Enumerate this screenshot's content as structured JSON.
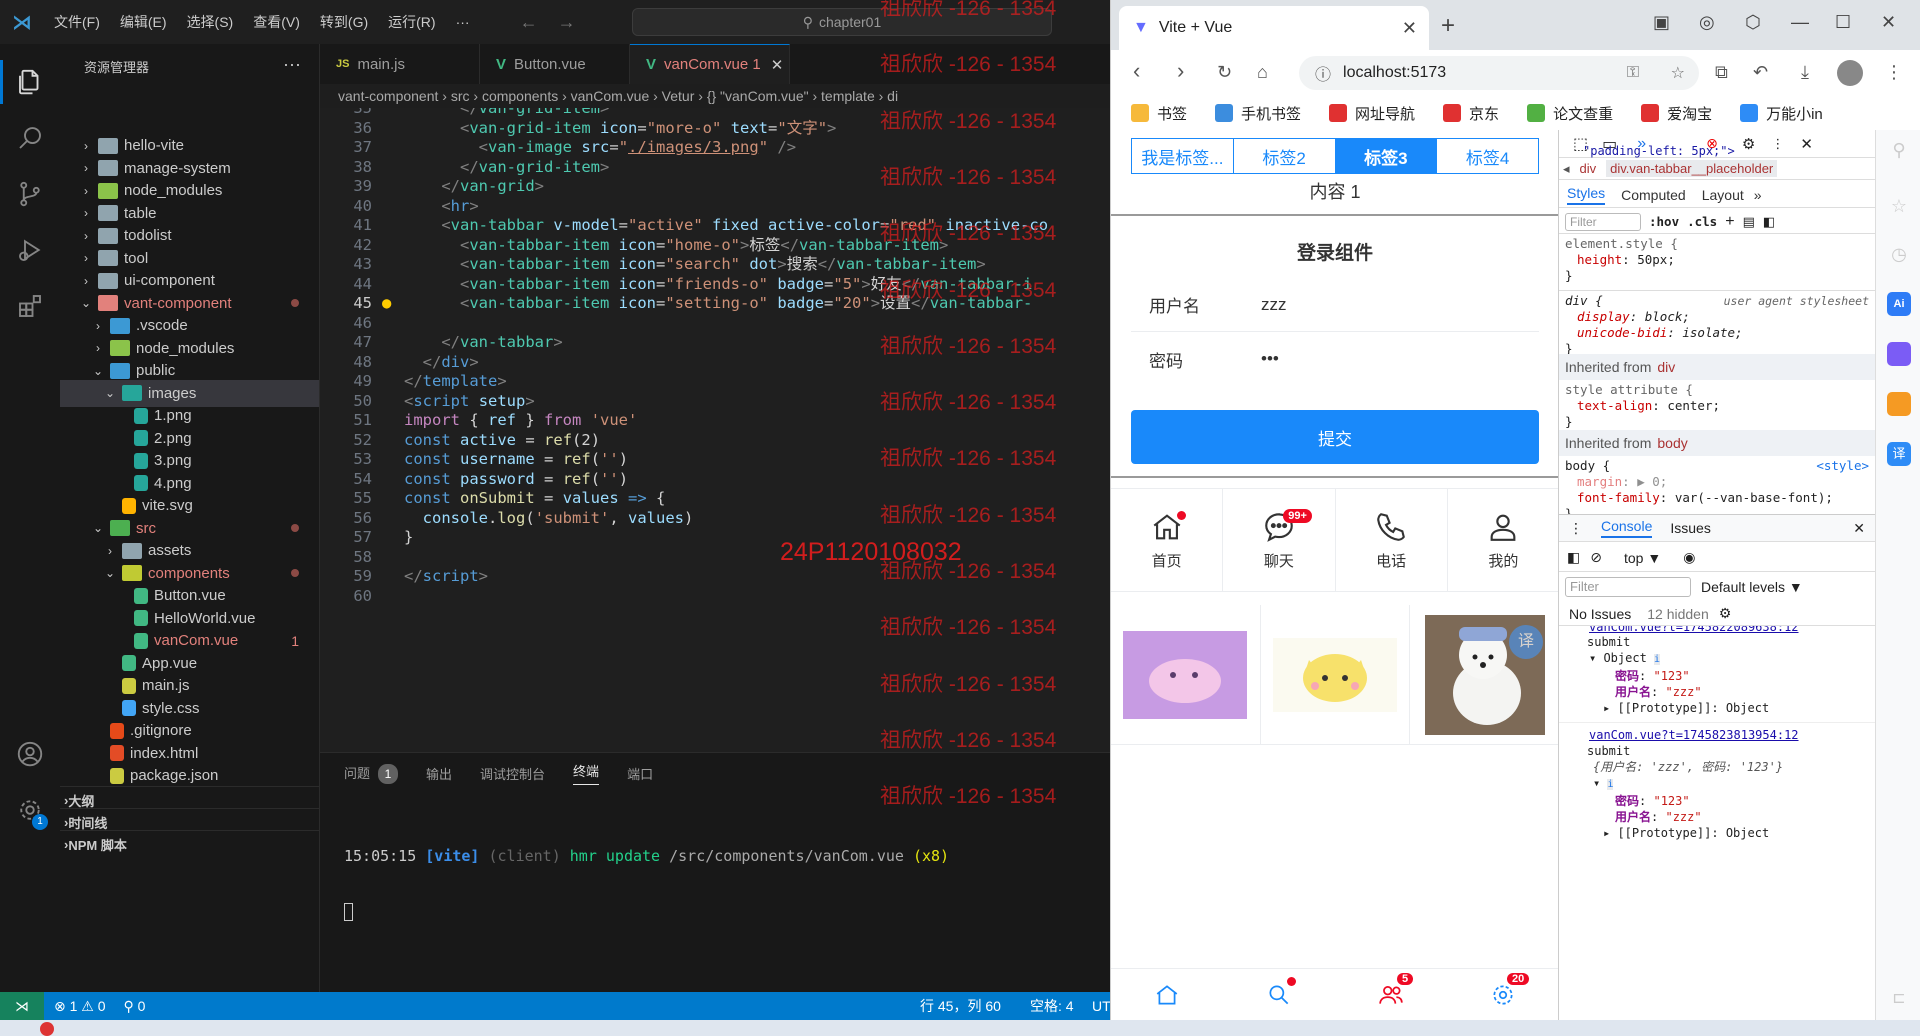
{
  "vscode": {
    "menu": [
      "文件(F)",
      "编辑(E)",
      "选择(S)",
      "查看(V)",
      "转到(G)",
      "运行(R)",
      "···"
    ],
    "command_center": "chapter01",
    "explorer_title": "资源管理器",
    "project": "CHAPTER01",
    "tree": [
      {
        "label": "hello-vite",
        "type": "folder"
      },
      {
        "label": "manage-system",
        "type": "folder"
      },
      {
        "label": "node_modules",
        "type": "folder-node"
      },
      {
        "label": "table",
        "type": "folder"
      },
      {
        "label": "todolist",
        "type": "folder"
      },
      {
        "label": "tool",
        "type": "folder"
      },
      {
        "label": "ui-component",
        "type": "folder"
      },
      {
        "label": "vant-component",
        "type": "folder-open-err"
      },
      {
        "label": ".vscode",
        "type": "folder-vscode"
      },
      {
        "label": "node_modules",
        "type": "folder-node"
      },
      {
        "label": "public",
        "type": "folder-public-open"
      },
      {
        "label": "images",
        "type": "folder-images-open"
      },
      {
        "label": "1.png",
        "type": "image"
      },
      {
        "label": "2.png",
        "type": "image"
      },
      {
        "label": "3.png",
        "type": "image"
      },
      {
        "label": "4.png",
        "type": "image"
      },
      {
        "label": "vite.svg",
        "type": "svg"
      },
      {
        "label": "src",
        "type": "folder-src-open-err"
      },
      {
        "label": "assets",
        "type": "folder"
      },
      {
        "label": "components",
        "type": "folder-comp-open-err"
      },
      {
        "label": "Button.vue",
        "type": "vue"
      },
      {
        "label": "HelloWorld.vue",
        "type": "vue"
      },
      {
        "label": "vanCom.vue",
        "type": "vue-err",
        "badge": "1"
      },
      {
        "label": "App.vue",
        "type": "vue"
      },
      {
        "label": "main.js",
        "type": "js"
      },
      {
        "label": "style.css",
        "type": "css"
      },
      {
        "label": ".gitignore",
        "type": "git"
      },
      {
        "label": "index.html",
        "type": "html"
      },
      {
        "label": "package.json",
        "type": "json"
      }
    ],
    "sections": [
      "大纲",
      "时间线",
      "NPM 脚本"
    ],
    "tabs": [
      {
        "label": "main.js",
        "icon": "JS"
      },
      {
        "label": "Button.vue",
        "icon": "V"
      },
      {
        "label": "vanCom.vue 1",
        "icon": "V",
        "active": true
      }
    ],
    "breadcrumb": "vant-component › src › components › vanCom.vue › Vetur › {} \"vanCom.vue\" › template › di",
    "panel_tabs": [
      "问题",
      "输出",
      "调试控制台",
      "终端",
      "端口"
    ],
    "problems_count": "1",
    "terminal_line": "15:05:15 [vite] (client) hmr update /src/components/vanCom.vue (x8)",
    "status": {
      "errors": "⊗ 1 ⚠ 0",
      "ports": "⚲ 0",
      "position": "行 45，列 60",
      "spaces": "空格: 4",
      "encoding": "UT"
    },
    "watermark": "祖欣欣 -126 - 1354",
    "watermark_id": "24P1120108032"
  },
  "browser": {
    "tab_title": "Vite + Vue",
    "url": "localhost:5173",
    "bookmarks": [
      "书签",
      "手机书签",
      "网址导航",
      "京东",
      "论文查重",
      "爱淘宝",
      "万能小in"
    ],
    "tabs": [
      "我是标签...",
      "标签2",
      "标签3",
      "标签4"
    ],
    "content": "内容 1",
    "login_title": "登录组件",
    "username_label": "用户名",
    "username_value": "zzz",
    "password_label": "密码",
    "password_value": "•••",
    "submit": "提交",
    "grid": [
      {
        "label": "首页",
        "icon": "home-icon",
        "dot": true
      },
      {
        "label": "聊天",
        "icon": "chat-icon",
        "badge": "99+"
      },
      {
        "label": "电话",
        "icon": "phone-icon"
      },
      {
        "label": "我的",
        "icon": "user-icon"
      }
    ],
    "tabbar_badges": {
      "friends": "5",
      "setting": "20"
    }
  },
  "devtools": {
    "top_css": "\"padding-left: 5px;\">",
    "breadcrumb_div": "div",
    "breadcrumb_sel": "div.van-tabbar__placeholder",
    "style_tabs": [
      "Styles",
      "Computed",
      "Layout"
    ],
    "filter": "Filter",
    "hov": ":hov",
    "cls": ".cls",
    "element_style": "element.style {",
    "height_prop": "height",
    "height_val": "50px;",
    "div_rule": "div {",
    "ua": "user agent stylesheet",
    "display_prop": "display",
    "display_val": "block;",
    "bidi_prop": "unicode-bidi",
    "bidi_val": "isolate;",
    "inherited_div": "Inherited from",
    "inherited_div_el": "div",
    "style_attr": "style attribute {",
    "ta_prop": "text-align",
    "ta_val": "center;",
    "inherited_body": "Inherited from",
    "inherited_body_el": "body",
    "body_rule": "body {",
    "style_link": "<style>",
    "margin_prop": "margin",
    "margin_val": "▶ 0;",
    "ff_prop": "font-family",
    "ff_val": "var(--van-base-font);",
    "console_tabs": [
      "Console",
      "Issues"
    ],
    "context": "top ▼",
    "levels": "Default levels ▼",
    "no_issues": "No Issues",
    "hidden": "12 hidden",
    "log1_src": "vanCom.vue?t=1745822089638:12",
    "log_submit": "submit",
    "obj": "Object",
    "pw_key": "密码",
    "pw_val": "\"123\"",
    "user_key": "用户名",
    "user_val": "\"zzz\"",
    "proto": "[[Prototype]]: Object",
    "log2_src": "vanCom.vue?t=1745823813954:12",
    "log2_obj": "{用户名: 'zzz', 密码: '123'}"
  }
}
